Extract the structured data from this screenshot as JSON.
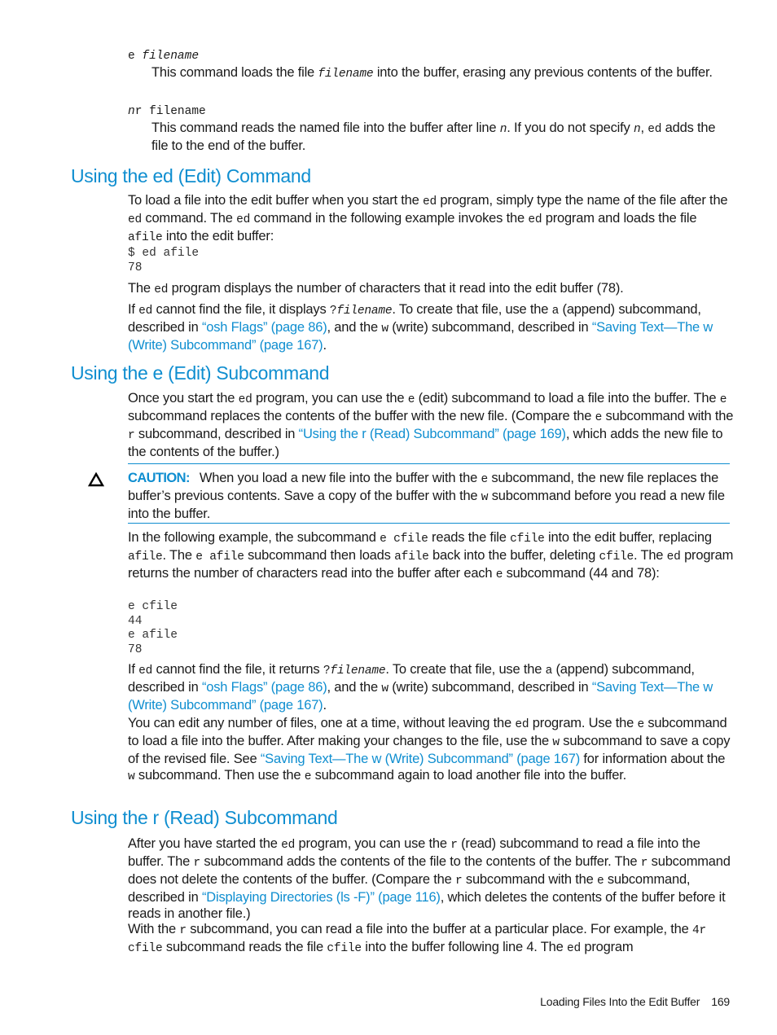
{
  "definitions": [
    {
      "term_plain": "e ",
      "term_italic": "filename",
      "desc_parts": [
        {
          "t": "This command loads the file "
        },
        {
          "t": "filename",
          "style": "mono-italic"
        },
        {
          "t": " into the buffer, erasing any previous contents of the buffer."
        }
      ]
    },
    {
      "term_italic": "n",
      "term_plain": "r filename",
      "desc_parts": [
        {
          "t": "This command reads the named file into the buffer after line "
        },
        {
          "t": "n",
          "style": "mono-italic"
        },
        {
          "t": ". If you do not specify "
        },
        {
          "t": "n",
          "style": "mono-italic"
        },
        {
          "t": ", "
        },
        {
          "t": "ed",
          "style": "mono"
        },
        {
          "t": " adds the file to the end of the buffer."
        }
      ]
    }
  ],
  "sections": {
    "ed_command": {
      "heading": "Using the ed (Edit) Command",
      "para1": [
        {
          "t": "To load a file into the edit buffer when you start the "
        },
        {
          "t": "ed",
          "style": "mono"
        },
        {
          "t": " program, simply type the name of the file after the "
        },
        {
          "t": "ed",
          "style": "mono"
        },
        {
          "t": " command. The "
        },
        {
          "t": "ed",
          "style": "mono"
        },
        {
          "t": " command in the following example invokes the "
        },
        {
          "t": "ed",
          "style": "mono"
        },
        {
          "t": " program and loads the file "
        },
        {
          "t": "afile",
          "style": "mono"
        },
        {
          "t": " into the edit buffer:"
        }
      ],
      "code": "$ ed afile\n78",
      "para2": [
        {
          "t": "The "
        },
        {
          "t": "ed",
          "style": "mono"
        },
        {
          "t": " program displays the number of characters that it read into the edit buffer (78)."
        }
      ],
      "para3": [
        {
          "t": "If "
        },
        {
          "t": "ed",
          "style": "mono"
        },
        {
          "t": " cannot find the file, it displays "
        },
        {
          "t": "?",
          "style": "mono"
        },
        {
          "t": "filename",
          "style": "mono-italic"
        },
        {
          "t": ". To create that file, use the "
        },
        {
          "t": "a",
          "style": "mono"
        },
        {
          "t": " (append) subcommand, described in "
        },
        {
          "t": "“osh Flags” (page 86)",
          "style": "link"
        },
        {
          "t": ", and the "
        },
        {
          "t": "w",
          "style": "mono"
        },
        {
          "t": " (write) subcommand, described in "
        },
        {
          "t": "“Saving Text—The w (Write) Subcommand” (page 167)",
          "style": "link"
        },
        {
          "t": "."
        }
      ]
    },
    "e_subcommand": {
      "heading": "Using the e (Edit) Subcommand",
      "para1": [
        {
          "t": "Once you start the "
        },
        {
          "t": "ed",
          "style": "mono"
        },
        {
          "t": " program, you can use the "
        },
        {
          "t": "e",
          "style": "mono"
        },
        {
          "t": " (edit) subcommand to load a file into the buffer. The "
        },
        {
          "t": "e",
          "style": "mono"
        },
        {
          "t": " subcommand replaces the contents of the buffer with the new file. (Compare the "
        },
        {
          "t": "e",
          "style": "mono"
        },
        {
          "t": " subcommand with the "
        },
        {
          "t": "r",
          "style": "mono"
        },
        {
          "t": " subcommand, described in "
        },
        {
          "t": "“Using the r (Read) Subcommand” (page 169)",
          "style": "link"
        },
        {
          "t": ", which adds the new file to the contents of the buffer.)"
        }
      ],
      "caution": {
        "label": "CAUTION:",
        "parts": [
          {
            "t": "When you load a new file into the buffer with the "
          },
          {
            "t": "e",
            "style": "mono"
          },
          {
            "t": " subcommand, the new file replaces the buffer’s previous contents. Save a copy of the buffer with the "
          },
          {
            "t": "w",
            "style": "mono"
          },
          {
            "t": " subcommand before you read a new file into the buffer."
          }
        ]
      },
      "para2": [
        {
          "t": "In the following example, the subcommand "
        },
        {
          "t": "e cfile",
          "style": "mono"
        },
        {
          "t": " reads the file "
        },
        {
          "t": "cfile",
          "style": "mono"
        },
        {
          "t": " into the edit buffer, replacing "
        },
        {
          "t": "afile",
          "style": "mono"
        },
        {
          "t": ". The "
        },
        {
          "t": "e afile",
          "style": "mono"
        },
        {
          "t": " subcommand then loads "
        },
        {
          "t": "afile",
          "style": "mono"
        },
        {
          "t": " back into the buffer, deleting "
        },
        {
          "t": "cfile",
          "style": "mono"
        },
        {
          "t": ". The "
        },
        {
          "t": "ed",
          "style": "mono"
        },
        {
          "t": " program returns the number of characters read into the buffer after each "
        },
        {
          "t": "e",
          "style": "mono"
        },
        {
          "t": " subcommand (44 and 78):"
        }
      ],
      "code": "e cfile\n44\ne afile\n78",
      "para3": [
        {
          "t": "If "
        },
        {
          "t": "ed",
          "style": "mono"
        },
        {
          "t": " cannot find the file, it returns "
        },
        {
          "t": "?",
          "style": "mono"
        },
        {
          "t": "filename",
          "style": "mono-italic"
        },
        {
          "t": ". To create that file, use the "
        },
        {
          "t": "a",
          "style": "mono"
        },
        {
          "t": " (append) subcommand, described in "
        },
        {
          "t": "“osh Flags” (page 86)",
          "style": "link"
        },
        {
          "t": ", and the "
        },
        {
          "t": "w",
          "style": "mono"
        },
        {
          "t": " (write) subcommand, described in "
        },
        {
          "t": "“Saving Text—The w (Write) Subcommand” (page 167)",
          "style": "link"
        },
        {
          "t": "."
        }
      ],
      "para4": [
        {
          "t": "You can edit any number of files, one at a time, without leaving the "
        },
        {
          "t": "ed",
          "style": "mono"
        },
        {
          "t": " program. Use the "
        },
        {
          "t": "e",
          "style": "mono"
        },
        {
          "t": " subcommand to load a file into the buffer. After making your changes to the file, use the "
        },
        {
          "t": "w",
          "style": "mono"
        },
        {
          "t": " subcommand to save a copy of the revised file. See "
        },
        {
          "t": "“Saving Text—The w (Write) Subcommand” (page 167)",
          "style": "link"
        },
        {
          "t": " for information about the "
        },
        {
          "t": "w",
          "style": "mono"
        },
        {
          "t": " subcommand. Then use the "
        },
        {
          "t": "e",
          "style": "mono"
        },
        {
          "t": " subcommand again to load another file into the buffer."
        }
      ]
    },
    "r_subcommand": {
      "heading": "Using the r (Read) Subcommand",
      "para1": [
        {
          "t": "After you have started the "
        },
        {
          "t": "ed",
          "style": "mono"
        },
        {
          "t": " program, you can use the "
        },
        {
          "t": "r",
          "style": "mono"
        },
        {
          "t": " (read) subcommand to read a file into the buffer. The "
        },
        {
          "t": "r",
          "style": "mono"
        },
        {
          "t": " subcommand adds the contents of the file to the contents of the buffer. The "
        },
        {
          "t": "r",
          "style": "mono"
        },
        {
          "t": " subcommand does not delete the contents of the buffer. (Compare the "
        },
        {
          "t": "r",
          "style": "mono"
        },
        {
          "t": " subcommand with the "
        },
        {
          "t": "e",
          "style": "mono"
        },
        {
          "t": " subcommand, described in "
        },
        {
          "t": "“Displaying Directories (ls -F)” (page 116)",
          "style": "link"
        },
        {
          "t": ", which deletes the contents of the buffer before it reads in another file.)"
        }
      ],
      "para2": [
        {
          "t": "With the "
        },
        {
          "t": "r",
          "style": "mono"
        },
        {
          "t": " subcommand, you can read a file into the buffer at a particular place. For example, the "
        },
        {
          "t": "4r cfile",
          "style": "mono"
        },
        {
          "t": " subcommand reads the file "
        },
        {
          "t": "cfile",
          "style": "mono"
        },
        {
          "t": " into the buffer following line 4. The "
        },
        {
          "t": "ed",
          "style": "mono"
        },
        {
          "t": " program"
        }
      ]
    }
  },
  "footer": {
    "title": "Loading Files Into the Edit Buffer",
    "page": "169"
  },
  "colors": {
    "accent": "#0f8ed0",
    "text": "#1a1a1a"
  }
}
